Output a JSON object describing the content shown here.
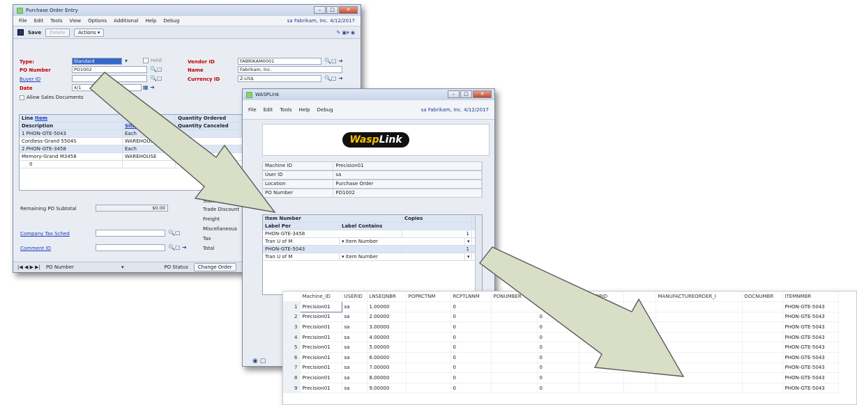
{
  "po_window": {
    "title": "Purchase Order Entry",
    "menu": [
      "File",
      "Edit",
      "Tools",
      "View",
      "Options",
      "Additional",
      "Help",
      "Debug"
    ],
    "company": "sa  Fabrikam, Inc.  4/12/2017",
    "toolbar": {
      "save": "Save",
      "delete": "Delete",
      "actions": "Actions ▾"
    },
    "labels": {
      "type": "Type:",
      "po_number": "PO Number",
      "buyer_id": "Buyer ID",
      "date": "Date",
      "hold": "Hold",
      "vendor_id": "Vendor ID",
      "name": "Name",
      "currency_id": "Currency ID",
      "allow_sales": "Allow Sales Documents"
    },
    "values": {
      "type": "Standard",
      "po_number": "PO1002",
      "date": "4/1",
      "vendor_id": "FABRIKAM0001",
      "name": "Fabrikam, Inc.",
      "currency_id": "Z-US$"
    },
    "grid": {
      "header1": [
        "Line",
        "Item",
        "",
        "Quantity Ordered"
      ],
      "header2": [
        "Description",
        "",
        "Site ID",
        "Quantity Canceled"
      ],
      "rows": [
        {
          "a": "1  PHON-GTE-5043",
          "b": "Each",
          "hl": true
        },
        {
          "a": "Cordless-Grand 5504S",
          "b": "WAREHOUSE",
          "hl": false
        },
        {
          "a": "2  PHON-GTE-3458",
          "b": "Each",
          "hl": true
        },
        {
          "a": "Memory-Grand M3458",
          "b": "WAREHOUSE",
          "hl": false
        },
        {
          "a": "0",
          "b": "",
          "hl": false
        }
      ]
    },
    "bottom": {
      "remaining": "Remaining PO Subtotal",
      "remaining_val": "$0.00",
      "company_tax": "Company Tax Sched",
      "comment": "Comment ID",
      "sub": "Subtotal",
      "trade": "Trade Discount",
      "freight": "Freight",
      "misc": "Miscellaneous",
      "tax": "Tax",
      "total": "Total"
    },
    "status": {
      "nav": "|◀ ◀ ▶ ▶|",
      "sort": "PO Number",
      "po_status": "PO Status",
      "change_order": "Change Order"
    }
  },
  "wasp_window": {
    "title": "WASPLink",
    "menu": [
      "File",
      "Edit",
      "Tools",
      "Help",
      "Debug"
    ],
    "company": "sa  Fabrikam, Inc.  4/12/2017",
    "logo_left": "Wasp",
    "logo_right": "Link",
    "fields": [
      {
        "label": "Machine ID",
        "value": "Precision01"
      },
      {
        "label": "User ID",
        "value": "sa"
      },
      {
        "label": "Location",
        "value": "Purchase Order"
      },
      {
        "label": "PO Number",
        "value": "PO1002"
      }
    ],
    "grid_header1": [
      "Item Number",
      "Copies"
    ],
    "grid_header2": [
      "Label Per",
      "Label Contains"
    ],
    "grid_rows": [
      {
        "a": "PHON-GTE-3458",
        "b": "",
        "c": "1",
        "hl": false
      },
      {
        "a": "Tran U of M",
        "b": "▾  Item Number",
        "c": "▾",
        "hl": false
      },
      {
        "a": "PHON-GTE-5043",
        "b": "",
        "c": "1",
        "hl": true
      },
      {
        "a": "Tran U of M",
        "b": "▾  Item Number",
        "c": "▾",
        "hl": false
      }
    ]
  },
  "spreadsheet": {
    "columns": [
      "Machine_ID",
      "USERID",
      "LNSEQNBR",
      "POPRCTNM",
      "RCPTLNNM",
      "PONUMBER",
      "",
      "VENDORID",
      "",
      "MANUFACTUREORDER_I",
      "DOCNUMBR",
      "ITEMNMBR"
    ],
    "rows": [
      {
        "n": "1",
        "m": "Precision01",
        "u": "sa",
        "l": "1.00000",
        "r": "0",
        "v": "0",
        "i": "PHON-GTE-5043"
      },
      {
        "n": "2",
        "m": "Precision01",
        "u": "sa",
        "l": "2.00000",
        "r": "0",
        "v": "0",
        "i": "PHON-GTE-5043"
      },
      {
        "n": "3",
        "m": "Precision01",
        "u": "sa",
        "l": "3.00000",
        "r": "0",
        "v": "0",
        "i": "PHON-GTE-5043"
      },
      {
        "n": "4",
        "m": "Precision01",
        "u": "sa",
        "l": "4.00000",
        "r": "0",
        "v": "0",
        "i": "PHON-GTE-5043"
      },
      {
        "n": "5",
        "m": "Precision01",
        "u": "sa",
        "l": "5.00000",
        "r": "0",
        "v": "0",
        "i": "PHON-GTE-5043"
      },
      {
        "n": "6",
        "m": "Precision01",
        "u": "sa",
        "l": "6.00000",
        "r": "0",
        "v": "0",
        "i": "PHON-GTE-5043"
      },
      {
        "n": "7",
        "m": "Precision01",
        "u": "sa",
        "l": "7.00000",
        "r": "0",
        "v": "0",
        "i": "PHON-GTE-5043"
      },
      {
        "n": "8",
        "m": "Precision01",
        "u": "sa",
        "l": "8.00000",
        "r": "0",
        "v": "0",
        "i": "PHON-GTE-5043"
      },
      {
        "n": "9",
        "m": "Precision01",
        "u": "sa",
        "l": "9.00000",
        "r": "0",
        "v": "0",
        "i": "PHON-GTE-5043"
      }
    ]
  },
  "colors": {
    "accent": "#3468c8",
    "required": "#c00000",
    "arrow_fill": "#d9dfc6",
    "arrow_stroke": "#5a5a5a"
  }
}
